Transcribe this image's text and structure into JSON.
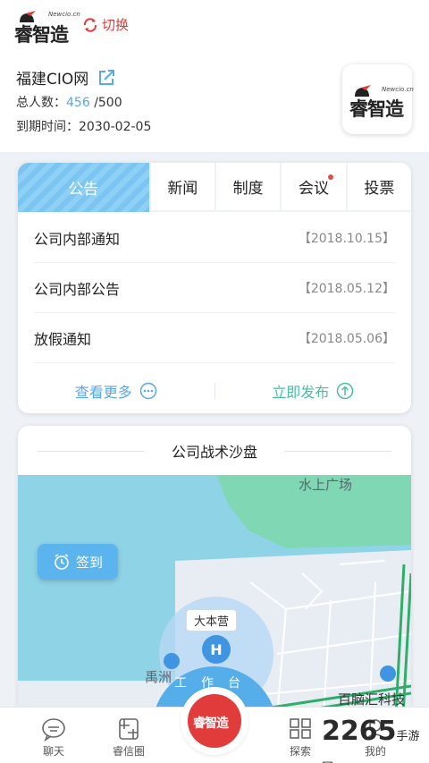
{
  "app": {
    "logo_text": "睿智造",
    "logo_sub": "Newcio.cn",
    "switch_label": "切换"
  },
  "company": {
    "name": "福建CIO网",
    "members_label": "总人数：",
    "members_count": "456",
    "members_total": "/500",
    "expire_label": "到期时间：",
    "expire_date": "2030-02-05"
  },
  "notice": {
    "tabs": [
      {
        "label": "公告",
        "active": true
      },
      {
        "label": "新闻"
      },
      {
        "label": "制度"
      },
      {
        "label": "会议",
        "badge": true
      },
      {
        "label": "投票"
      }
    ],
    "items": [
      {
        "title": "公司内部通知",
        "date": "【2018.10.15】"
      },
      {
        "title": "公司内部公告",
        "date": "【2018.05.12】"
      },
      {
        "title": "放假通知",
        "date": "【2018.05.06】"
      }
    ],
    "view_more": "查看更多",
    "publish": "立即发布"
  },
  "map_section": {
    "title": "公司战术沙盘",
    "checkin": "签到",
    "labels": [
      "水上广场",
      "大本营",
      "禹洲",
      "百脑汇科技"
    ],
    "workbench": "工作台"
  },
  "bottom_nav": [
    {
      "label": "聊天"
    },
    {
      "label": "睿信圈"
    },
    {
      "label": "探索"
    },
    {
      "label": "我的"
    }
  ],
  "watermark": {
    "big": "2265",
    "small": "手游网"
  },
  "colors": {
    "accent": "#5aa9e6",
    "brand_red": "#e23b3b",
    "green": "#47bfa0"
  }
}
